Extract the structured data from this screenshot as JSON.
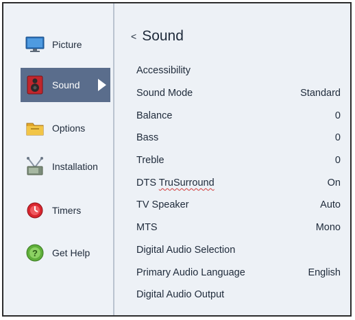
{
  "sidebar": {
    "items": [
      {
        "label": "Picture",
        "icon": "monitor-icon",
        "selected": false
      },
      {
        "label": "Sound",
        "icon": "speaker-icon",
        "selected": true
      },
      {
        "label": "Options",
        "icon": "folder-icon",
        "selected": false
      },
      {
        "label": "Installation",
        "icon": "antenna-icon",
        "selected": false
      },
      {
        "label": "Timers",
        "icon": "alarm-icon",
        "selected": false
      },
      {
        "label": "Get Help",
        "icon": "help-icon",
        "selected": false
      }
    ]
  },
  "main": {
    "back_glyph": "<",
    "title": "Sound",
    "settings": [
      {
        "label_pre": "Accessibility",
        "label_squiggle": "",
        "value": ""
      },
      {
        "label_pre": "Sound Mode",
        "label_squiggle": "",
        "value": "Standard"
      },
      {
        "label_pre": "Balance",
        "label_squiggle": "",
        "value": "0"
      },
      {
        "label_pre": "Bass",
        "label_squiggle": "",
        "value": "0"
      },
      {
        "label_pre": "Treble",
        "label_squiggle": "",
        "value": "0"
      },
      {
        "label_pre": "DTS ",
        "label_squiggle": "TruSurround",
        "value": "On"
      },
      {
        "label_pre": "TV Speaker",
        "label_squiggle": "",
        "value": "Auto"
      },
      {
        "label_pre": "MTS",
        "label_squiggle": "",
        "value": "Mono"
      },
      {
        "label_pre": "Digital Audio Selection",
        "label_squiggle": "",
        "value": ""
      },
      {
        "label_pre": "Primary Audio Language",
        "label_squiggle": "",
        "value": "English"
      },
      {
        "label_pre": "Digital Audio Output",
        "label_squiggle": "",
        "value": ""
      }
    ]
  },
  "colors": {
    "selected_bg": "#5a6d8c",
    "panel_bg": "#edf1f6",
    "text": "#1e2a3a"
  }
}
